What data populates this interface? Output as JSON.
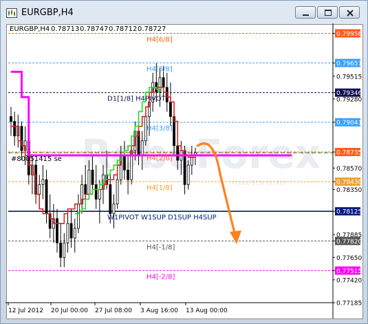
{
  "window": {
    "title": "EURGBP,H4",
    "buttons": [
      "minimize-icon",
      "maximize-icon",
      "close-icon"
    ]
  },
  "chart": {
    "info": {
      "symbol": "EURGBP,H4",
      "open": "0.78713",
      "high": "0.78747",
      "low": "0.78712",
      "close": "0.78727"
    },
    "watermark": {
      "main": "RoboForex",
      "sub": "Forex ECN Broker"
    },
    "marker_text": "#80051415 se",
    "bottom_levels_label": "W1PIVOT W1SUP D1SUP H4SUP",
    "mid_levels_label": "D1[1/8] H4PIVOT"
  },
  "chart_data": {
    "type": "candlestick",
    "ylim": [
      0.77185,
      0.8003
    ],
    "y_ticks": [
      "0.79956",
      "0.79651",
      "0.79515",
      "0.79346",
      "0.79280",
      "0.79041",
      "0.78735",
      "0.78570",
      "0.78430",
      "0.78350",
      "0.78125",
      "0.77885",
      "0.77820",
      "0.77650",
      "0.77515",
      "0.77420",
      "0.77185"
    ],
    "highlighted_prices": [
      {
        "value": "0.79956",
        "color": "#ff5a1e"
      },
      {
        "value": "0.79651",
        "color": "#3aa0ff"
      },
      {
        "value": "0.79346",
        "color": "#101050"
      },
      {
        "value": "0.79041",
        "color": "#3aa0ff"
      },
      {
        "value": "0.78735",
        "color": "#ff5a1e"
      },
      {
        "value": "0.78430",
        "color": "#f0a030"
      },
      {
        "value": "0.78125",
        "color": "#001a80"
      },
      {
        "value": "0.77820",
        "color": "#555555"
      },
      {
        "value": "0.77515",
        "color": "#ff00ff"
      }
    ],
    "x_ticks": [
      "12 Jul 2012",
      "20 Jul 00:00",
      "27 Jul 08:00",
      "3 Aug 16:00",
      "13 Aug 00:00"
    ],
    "levels": [
      {
        "label": "H4[6/8]",
        "value": 0.79956,
        "color": "#ff5a1e"
      },
      {
        "label": "H4[5/8]",
        "value": 0.79651,
        "color": "#3aa0ff"
      },
      {
        "label": "D1[1/8] H4PIVOT",
        "value": 0.79346,
        "color": "#101050"
      },
      {
        "label": "H4[3/8]",
        "value": 0.79041,
        "color": "#3aa0ff"
      },
      {
        "label": "H4[2/8]",
        "value": 0.78735,
        "color": "#ff5a1e"
      },
      {
        "label": "H4[1/8]",
        "value": 0.7843,
        "color": "#f0a030"
      },
      {
        "label": "W1PIVOT W1SUP D1SUP H4SUP",
        "value": 0.78125,
        "color": "#001a80"
      },
      {
        "label": "H4[-1/8]",
        "value": 0.7782,
        "color": "#555555"
      },
      {
        "label": "H4[-2/8]",
        "value": 0.77515,
        "color": "#ff00ff"
      }
    ],
    "series": [
      {
        "name": "candles",
        "values": [
          [
            0.791,
            0.792,
            0.789,
            0.7905
          ],
          [
            0.7905,
            0.7915,
            0.788,
            0.789
          ],
          [
            0.789,
            0.7912,
            0.7878,
            0.79
          ],
          [
            0.79,
            0.7905,
            0.7865,
            0.7875
          ],
          [
            0.7875,
            0.79,
            0.786,
            0.7885
          ],
          [
            0.7885,
            0.7895,
            0.784,
            0.785
          ],
          [
            0.785,
            0.787,
            0.783,
            0.786
          ],
          [
            0.786,
            0.7865,
            0.782,
            0.783
          ],
          [
            0.783,
            0.785,
            0.7815,
            0.784
          ],
          [
            0.784,
            0.786,
            0.7825,
            0.7845
          ],
          [
            0.7845,
            0.7855,
            0.78,
            0.781
          ],
          [
            0.781,
            0.783,
            0.7785,
            0.7795
          ],
          [
            0.7795,
            0.782,
            0.778,
            0.7805
          ],
          [
            0.7805,
            0.7815,
            0.777,
            0.778
          ],
          [
            0.778,
            0.78,
            0.7755,
            0.7765
          ],
          [
            0.7765,
            0.779,
            0.7755,
            0.778
          ],
          [
            0.778,
            0.781,
            0.777,
            0.78
          ],
          [
            0.78,
            0.7815,
            0.7775,
            0.7785
          ],
          [
            0.7785,
            0.7805,
            0.777,
            0.7795
          ],
          [
            0.7795,
            0.783,
            0.779,
            0.782
          ],
          [
            0.782,
            0.785,
            0.781,
            0.784
          ],
          [
            0.784,
            0.786,
            0.782,
            0.783
          ],
          [
            0.783,
            0.7865,
            0.7825,
            0.7855
          ],
          [
            0.7855,
            0.787,
            0.783,
            0.784
          ],
          [
            0.784,
            0.786,
            0.7815,
            0.7825
          ],
          [
            0.7825,
            0.7845,
            0.78,
            0.7835
          ],
          [
            0.7835,
            0.786,
            0.782,
            0.785
          ],
          [
            0.785,
            0.7875,
            0.7835,
            0.784
          ],
          [
            0.784,
            0.7855,
            0.78,
            0.781
          ],
          [
            0.781,
            0.783,
            0.7795,
            0.782
          ],
          [
            0.782,
            0.785,
            0.7815,
            0.7845
          ],
          [
            0.7845,
            0.788,
            0.784,
            0.787
          ],
          [
            0.787,
            0.7885,
            0.7845,
            0.7855
          ],
          [
            0.7855,
            0.787,
            0.783,
            0.7845
          ],
          [
            0.7845,
            0.788,
            0.784,
            0.7875
          ],
          [
            0.7875,
            0.7905,
            0.7865,
            0.7895
          ],
          [
            0.7895,
            0.791,
            0.786,
            0.787
          ],
          [
            0.787,
            0.7895,
            0.7855,
            0.7885
          ],
          [
            0.7885,
            0.792,
            0.788,
            0.791
          ],
          [
            0.791,
            0.7935,
            0.789,
            0.7925
          ],
          [
            0.7925,
            0.7955,
            0.7915,
            0.7945
          ],
          [
            0.7945,
            0.7965,
            0.7925,
            0.7935
          ],
          [
            0.7935,
            0.796,
            0.792,
            0.795
          ],
          [
            0.795,
            0.7962,
            0.793,
            0.794
          ],
          [
            0.794,
            0.7955,
            0.7915,
            0.7925
          ],
          [
            0.7925,
            0.7945,
            0.79,
            0.791
          ],
          [
            0.791,
            0.7925,
            0.787,
            0.788
          ],
          [
            0.788,
            0.7895,
            0.7855,
            0.7865
          ],
          [
            0.7865,
            0.7885,
            0.785,
            0.7875
          ],
          [
            0.7875,
            0.788,
            0.783,
            0.784
          ],
          [
            0.784,
            0.7865,
            0.7835,
            0.786
          ],
          [
            0.786,
            0.788,
            0.785,
            0.787
          ],
          [
            0.787,
            0.7878,
            0.786,
            0.7873
          ]
        ]
      },
      {
        "name": "red line",
        "color": "#e02020",
        "values": [
          0.79,
          0.79,
          0.7885,
          0.788,
          0.787,
          0.786,
          0.785,
          0.783,
          0.7815,
          0.781,
          0.781,
          0.7805,
          0.78,
          0.78,
          0.78,
          0.781,
          0.7815,
          0.7815,
          0.782,
          0.782,
          0.7825,
          0.783,
          0.783,
          0.7835,
          0.7835,
          0.7835,
          0.784,
          0.7845,
          0.7845,
          0.785,
          0.786,
          0.787,
          0.787,
          0.787,
          0.788,
          0.789,
          0.79,
          0.791,
          0.792,
          0.7935,
          0.794,
          0.794,
          0.794,
          0.7935,
          0.793,
          0.7925,
          0.7905,
          0.788,
          0.7875,
          0.787,
          0.7868,
          0.7868,
          0.7868
        ]
      },
      {
        "name": "green line",
        "color": "#22dd22",
        "values": [
          null,
          null,
          null,
          null,
          null,
          null,
          null,
          null,
          null,
          null,
          null,
          null,
          null,
          null,
          null,
          null,
          null,
          null,
          0.781,
          0.7812,
          0.7815,
          0.7825,
          0.783,
          0.7835,
          0.7835,
          0.784,
          0.7845,
          0.785,
          0.7855,
          0.786,
          0.7865,
          0.787,
          0.7875,
          0.788,
          0.789,
          0.79,
          0.7915,
          0.7925,
          0.7935,
          0.794,
          0.794,
          0.7938,
          0.7935,
          null,
          null,
          null,
          null,
          null,
          null,
          null,
          null,
          null,
          null
        ]
      },
      {
        "name": "magenta line",
        "color": "#ff00ff",
        "values": [
          0.7956,
          0.7956,
          0.7956,
          0.793,
          0.793,
          0.787,
          0.787,
          0.787,
          0.787,
          0.787,
          0.787,
          0.787,
          0.787,
          0.787,
          0.787,
          0.787,
          0.787,
          0.787,
          0.787,
          0.787,
          0.787,
          0.787,
          0.787,
          0.787,
          0.787,
          0.787,
          0.787,
          0.787,
          0.787,
          0.787,
          0.787,
          0.787,
          0.787,
          0.787,
          0.787,
          0.787,
          0.787,
          0.787,
          0.787,
          0.787,
          0.787,
          0.787,
          0.787,
          0.787,
          0.787,
          0.787,
          0.787,
          0.787,
          0.787,
          0.787,
          0.787,
          0.787,
          0.787
        ]
      }
    ],
    "forecast_arrow": {
      "color": "#ff8020",
      "from": 0.7875,
      "to": 0.779
    }
  }
}
